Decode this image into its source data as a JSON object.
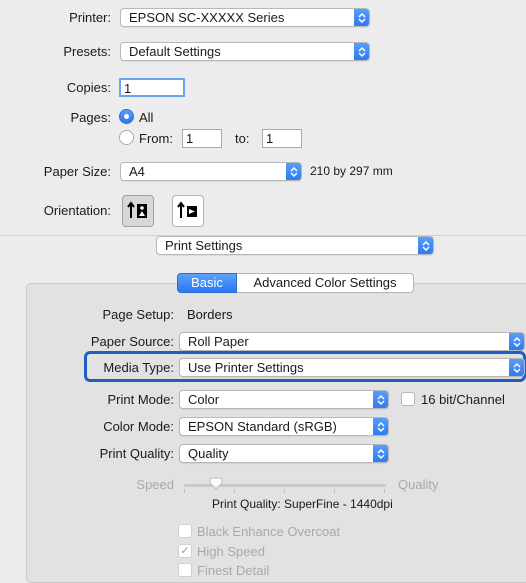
{
  "printer": {
    "label": "Printer:",
    "value": "EPSON SC-XXXXX Series"
  },
  "presets": {
    "label": "Presets:",
    "value": "Default Settings"
  },
  "copies": {
    "label": "Copies:",
    "value": "1"
  },
  "pages": {
    "label": "Pages:",
    "all_label": "All",
    "from_label": "From:",
    "from_value": "1",
    "to_label": "to:",
    "to_value": "1",
    "selected": "All"
  },
  "paper_size": {
    "label": "Paper Size:",
    "value": "A4",
    "dimensions": "210 by 297 mm"
  },
  "orientation": {
    "label": "Orientation:",
    "selected": "portrait"
  },
  "section_popup": {
    "value": "Print Settings"
  },
  "tabs": [
    {
      "label": "Basic",
      "selected": true
    },
    {
      "label": "Advanced Color Settings",
      "selected": false
    }
  ],
  "settings": {
    "page_setup": {
      "label": "Page Setup:",
      "value": "Borders"
    },
    "paper_source": {
      "label": "Paper Source:",
      "value": "Roll Paper"
    },
    "media_type": {
      "label": "Media Type:",
      "value": "Use Printer Settings"
    },
    "print_mode": {
      "label": "Print Mode:",
      "value": "Color"
    },
    "bit_channel": {
      "label": "16 bit/Channel",
      "checked": false
    },
    "color_mode": {
      "label": "Color Mode:",
      "value": "EPSON Standard (sRGB)"
    },
    "print_quality": {
      "label": "Print Quality:",
      "value": "Quality"
    },
    "slider": {
      "left_label": "Speed",
      "right_label": "Quality",
      "caption": "Print Quality: SuperFine - 1440dpi",
      "level_fraction": 0.16
    },
    "black_enhance": {
      "label": "Black Enhance Overcoat",
      "checked": false
    },
    "high_speed": {
      "label": "High Speed",
      "checked": true
    },
    "finest_detail": {
      "label": "Finest Detail",
      "checked": false
    }
  },
  "colors": {
    "accent": "#2b78f0",
    "focus": "#1f5fbf",
    "background": "#ececec"
  }
}
